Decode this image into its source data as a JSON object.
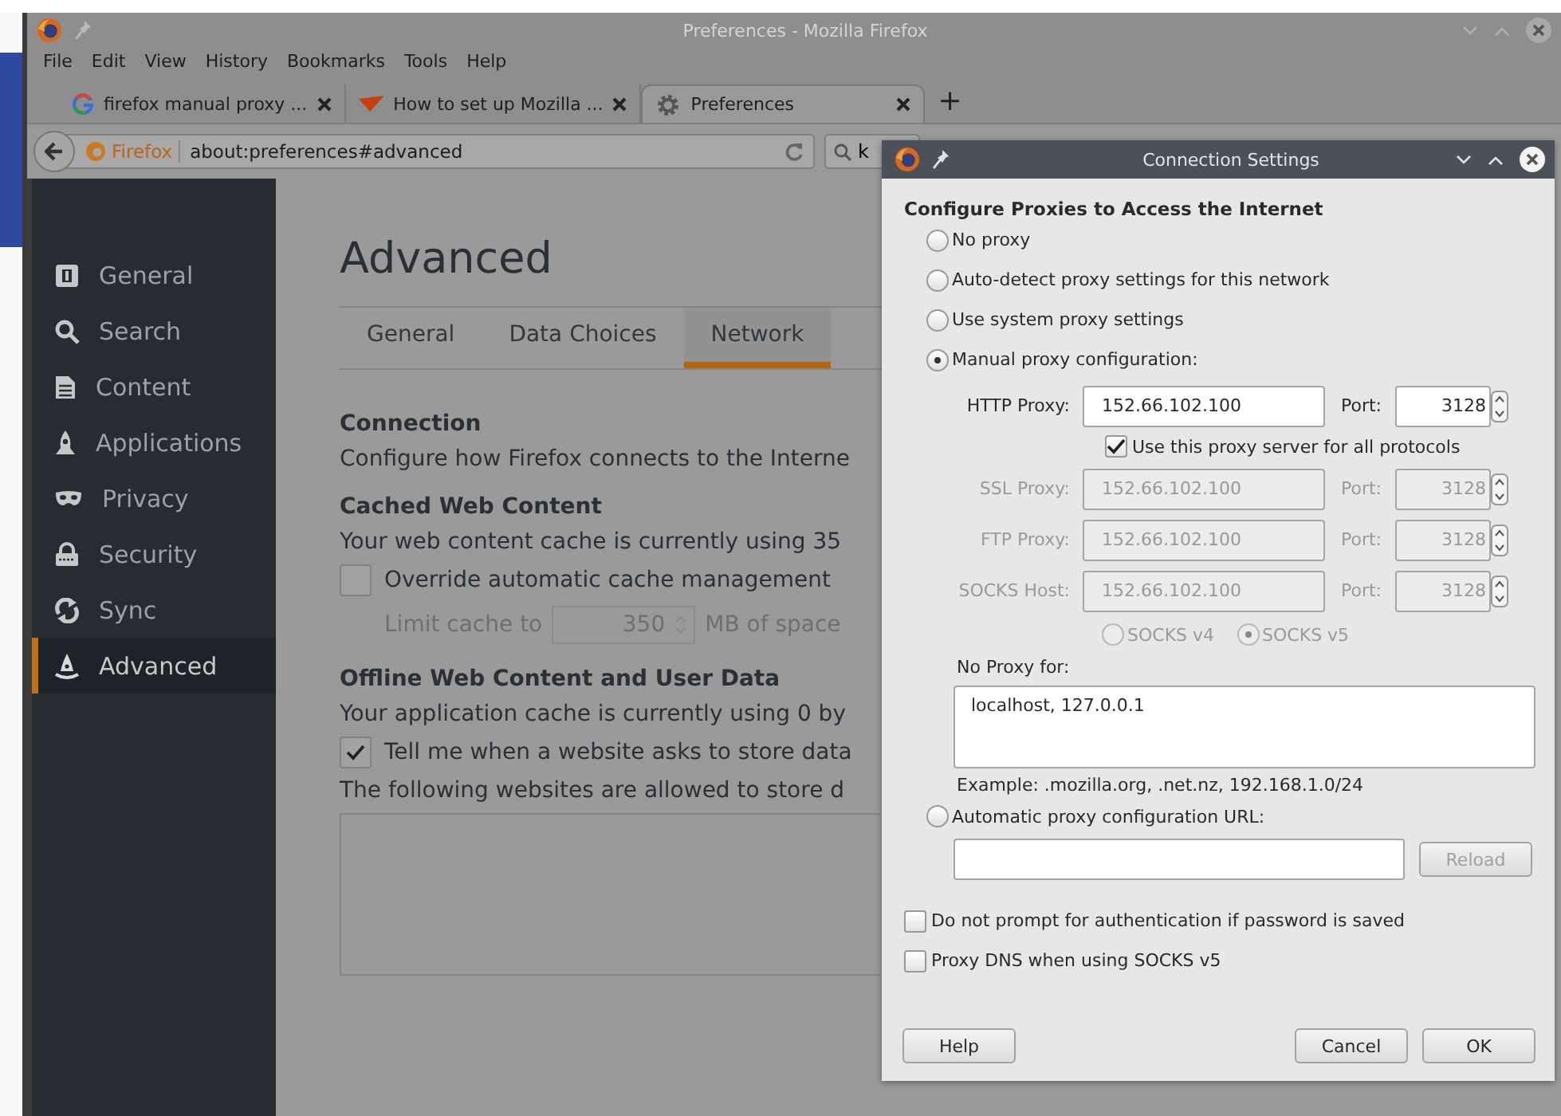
{
  "browser": {
    "title": "Preferences - Mozilla Firefox",
    "menu": [
      "File",
      "Edit",
      "View",
      "History",
      "Bookmarks",
      "Tools",
      "Help"
    ],
    "tabs": [
      {
        "label": "firefox manual proxy ...",
        "selected": false
      },
      {
        "label": "How to set up Mozilla ...",
        "selected": false
      },
      {
        "label": "Preferences",
        "selected": true
      }
    ],
    "new_tab": "+",
    "identity": "Firefox",
    "address": "about:preferences#advanced",
    "search": "k"
  },
  "sidebar": {
    "items": [
      {
        "label": "General",
        "selected": false
      },
      {
        "label": "Search",
        "selected": false
      },
      {
        "label": "Content",
        "selected": false
      },
      {
        "label": "Applications",
        "selected": false
      },
      {
        "label": "Privacy",
        "selected": false
      },
      {
        "label": "Security",
        "selected": false
      },
      {
        "label": "Sync",
        "selected": false
      },
      {
        "label": "Advanced",
        "selected": true
      }
    ]
  },
  "page": {
    "heading": "Advanced",
    "tabs": [
      {
        "label": "General",
        "selected": false
      },
      {
        "label": "Data Choices",
        "selected": false
      },
      {
        "label": "Network",
        "selected": true
      }
    ],
    "sections": [
      {
        "title": "Connection",
        "rows": [
          {
            "kind": "text",
            "text": "Configure how Firefox connects to the Interne"
          }
        ]
      },
      {
        "title": "Cached Web Content",
        "rows": [
          {
            "kind": "text",
            "text": "Your web content cache is currently using 35"
          },
          {
            "kind": "checkbox",
            "label": "Override automatic cache management",
            "checked": false
          },
          {
            "kind": "limit",
            "label": "Limit cache to",
            "value": "350",
            "unit": "MB of space",
            "disabled": true
          }
        ]
      },
      {
        "title": "Offline Web Content and User Data",
        "rows": [
          {
            "kind": "text",
            "text": "Your application cache is currently using 0 by"
          },
          {
            "kind": "checkbox",
            "label": "Tell me when a website asks to store data",
            "checked": true
          },
          {
            "kind": "text",
            "text": "The following websites are allowed to store d"
          },
          {
            "kind": "listbox"
          }
        ]
      }
    ]
  },
  "dialog": {
    "title": "Connection Settings",
    "heading": "Configure Proxies to Access the Internet",
    "modes": [
      {
        "label": "No proxy",
        "selected": false
      },
      {
        "label": "Auto-detect proxy settings for this network",
        "selected": false
      },
      {
        "label": "Use system proxy settings",
        "selected": false
      },
      {
        "label": "Manual proxy configuration:",
        "selected": true
      }
    ],
    "proxies": [
      {
        "label": "HTTP Proxy:",
        "host": "152.66.102.100",
        "port_label": "Port:",
        "port": "3128",
        "disabled": false
      },
      {
        "label": "SSL Proxy:",
        "host": "152.66.102.100",
        "port_label": "Port:",
        "port": "3128",
        "disabled": true
      },
      {
        "label": "FTP Proxy:",
        "host": "152.66.102.100",
        "port_label": "Port:",
        "port": "3128",
        "disabled": true
      },
      {
        "label": "SOCKS Host:",
        "host": "152.66.102.100",
        "port_label": "Port:",
        "port": "3128",
        "disabled": true
      }
    ],
    "share": {
      "label": "Use this proxy server for all protocols",
      "checked": true
    },
    "socks_versions": {
      "disabled": true,
      "items": [
        {
          "label": "SOCKS v4",
          "selected": false
        },
        {
          "label": "SOCKS v5",
          "selected": true
        }
      ]
    },
    "no_proxy": {
      "label": "No Proxy for:",
      "value": "localhost, 127.0.0.1",
      "example": "Example: .mozilla.org, .net.nz, 192.168.1.0/24"
    },
    "auto": {
      "label": "Automatic proxy configuration URL:",
      "selected": false,
      "reload": "Reload",
      "reload_disabled": true
    },
    "options": [
      {
        "label": "Do not prompt for authentication if password is saved",
        "checked": false
      },
      {
        "label": "Proxy DNS when using SOCKS v5",
        "checked": false
      }
    ],
    "buttons": {
      "help": "Help",
      "cancel": "Cancel",
      "ok": "OK"
    }
  }
}
